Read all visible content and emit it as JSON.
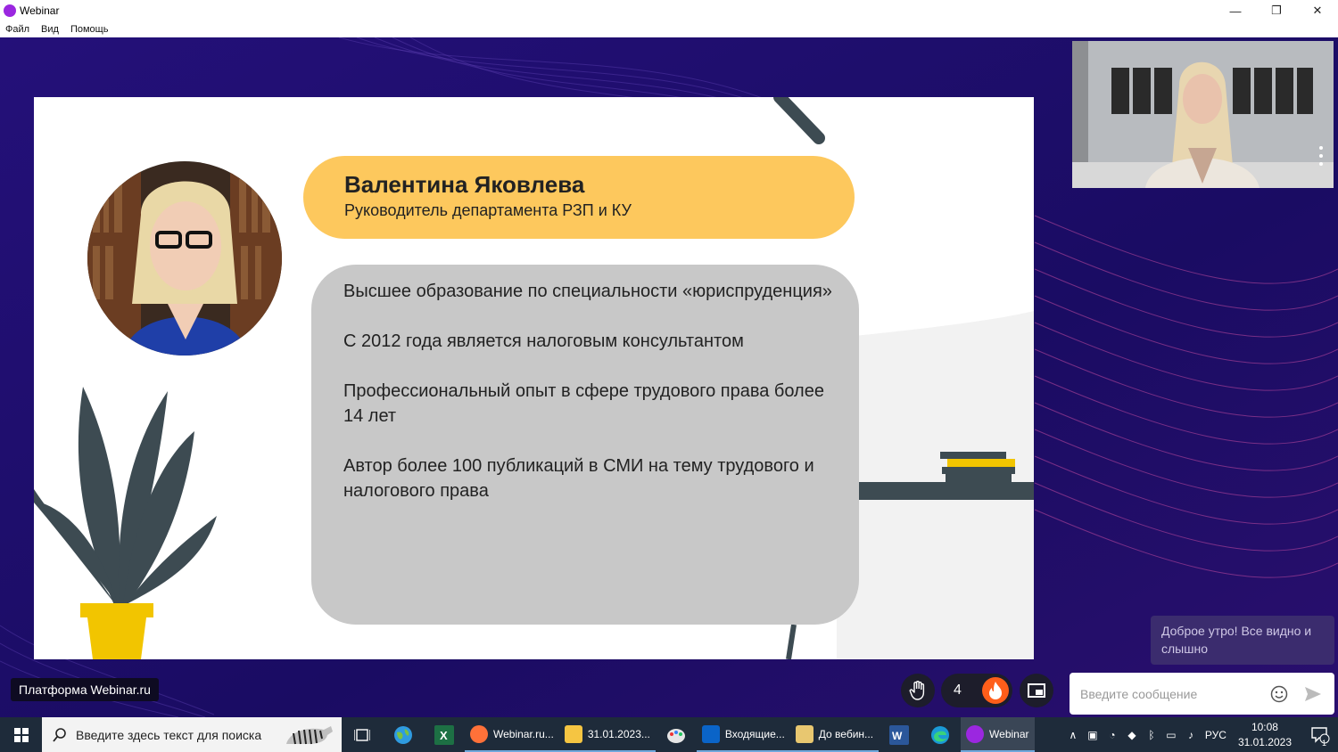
{
  "window": {
    "title": "Webinar",
    "controls": [
      "—",
      "❐",
      "✕"
    ]
  },
  "menu": [
    "Файл",
    "Вид",
    "Помощь"
  ],
  "slide": {
    "speaker_name": "Валентина Яковлева",
    "speaker_role": "Руководитель департамента РЗП и КУ",
    "bio": [
      "Высшее образование по специальности «юриспруденция»",
      "С 2012 года является налоговым консультантом",
      "Профессиональный опыт в сфере трудового права более 14 лет",
      "Автор более 100 публикаций в СМИ на тему трудового и налогового права"
    ]
  },
  "chat": {
    "last_message": "Доброе утро! Все видно и слышно",
    "input_placeholder": "Введите сообщение"
  },
  "branding": "Платформа Webinar.ru",
  "controls": {
    "reaction_count": "4"
  },
  "taskbar": {
    "search_placeholder": "Введите здесь текст для поиска",
    "apps": [
      {
        "label": "Webinar.ru...",
        "color": "#ff7139"
      },
      {
        "label": "31.01.2023...",
        "color": "#f5c542"
      },
      {
        "label": "Входящие...",
        "color": "#0a64c8"
      },
      {
        "label": "До вебин...",
        "color": "#e8c770"
      },
      {
        "label": "Webinar",
        "color": "#9b27e0"
      }
    ],
    "lang": "РУС",
    "time": "10:08",
    "date": "31.01.2023",
    "notification_count": "1"
  },
  "colors": {
    "stage_bg": "#1b0e66",
    "name_pill": "#fdc85d",
    "bio_box": "#c8c8c8",
    "taskbar": "#1e2b3a",
    "accent_purple": "#9b27e0",
    "fire": "#ff5e1a"
  }
}
